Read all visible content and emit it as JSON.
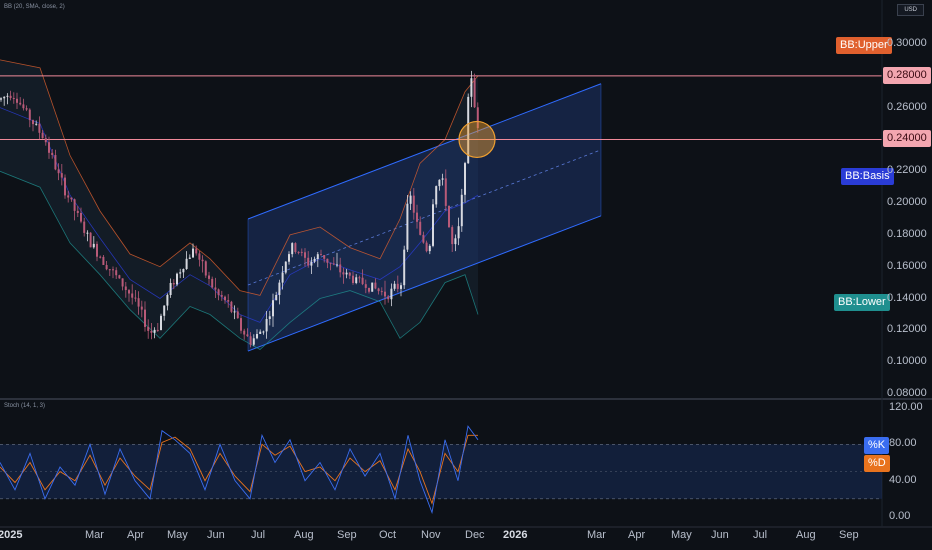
{
  "indicators": {
    "bb_legend": "BB (20, SMA, close, 2)",
    "stoch_legend": "Stoch (14, 1, 3)",
    "currency": "USD"
  },
  "labels": {
    "bb_upper": "BB:Upper",
    "bb_basis": "BB:Basis",
    "bb_lower": "BB:Lower",
    "level_high": "0.28000",
    "level_low": "0.24000",
    "pct_k": "%K",
    "pct_d": "%D"
  },
  "colors": {
    "background": "#0d1117",
    "candle_up": "#d7d9e0",
    "candle_down": "#b95a78",
    "bb_upper": "#e0602e",
    "bb_basis": "#2a3cd6",
    "bb_lower": "#1f8f8f",
    "level_line": "#f08a9a",
    "channel": "#2f6bff",
    "highlight_circle": "#f0a030",
    "stoch_k": "#3a6df0",
    "stoch_d": "#e8731e"
  },
  "chart_data": {
    "type": "line",
    "title": "",
    "main_y_ticks": [
      "0.30000",
      "0.28000",
      "0.26000",
      "0.24000",
      "0.22000",
      "0.20000",
      "0.18000",
      "0.16000",
      "0.14000",
      "0.12000",
      "0.10000",
      "0.08000"
    ],
    "main_ylim": [
      0.08,
      0.305
    ],
    "stoch_y_ticks": [
      "120.00",
      "80.00",
      "40.00",
      "0.00"
    ],
    "stoch_ylim": [
      0,
      120
    ],
    "x_ticks": [
      "2025",
      "Mar",
      "Apr",
      "May",
      "Jun",
      "Jul",
      "Aug",
      "Sep",
      "Oct",
      "Nov",
      "Dec",
      "2026",
      "Mar",
      "Apr",
      "May",
      "Jun",
      "Jul",
      "Aug",
      "Sep"
    ],
    "horizontal_levels": [
      0.28,
      0.24
    ],
    "stoch_band": [
      20,
      80
    ],
    "price_path": [
      [
        0,
        0.265
      ],
      [
        12,
        0.27
      ],
      [
        28,
        0.255
      ],
      [
        45,
        0.24
      ],
      [
        60,
        0.215
      ],
      [
        75,
        0.195
      ],
      [
        90,
        0.175
      ],
      [
        105,
        0.163
      ],
      [
        118,
        0.152
      ],
      [
        130,
        0.143
      ],
      [
        140,
        0.132
      ],
      [
        150,
        0.118
      ],
      [
        158,
        0.123
      ],
      [
        165,
        0.137
      ],
      [
        172,
        0.15
      ],
      [
        180,
        0.158
      ],
      [
        188,
        0.166
      ],
      [
        195,
        0.172
      ],
      [
        202,
        0.16
      ],
      [
        210,
        0.15
      ],
      [
        218,
        0.142
      ],
      [
        226,
        0.138
      ],
      [
        234,
        0.13
      ],
      [
        242,
        0.12
      ],
      [
        250,
        0.113
      ],
      [
        258,
        0.117
      ],
      [
        266,
        0.125
      ],
      [
        275,
        0.14
      ],
      [
        283,
        0.16
      ],
      [
        291,
        0.172
      ],
      [
        299,
        0.17
      ],
      [
        307,
        0.162
      ],
      [
        315,
        0.165
      ],
      [
        322,
        0.168
      ],
      [
        330,
        0.162
      ],
      [
        338,
        0.158
      ],
      [
        346,
        0.155
      ],
      [
        354,
        0.152
      ],
      [
        362,
        0.15
      ],
      [
        370,
        0.148
      ],
      [
        378,
        0.145
      ],
      [
        386,
        0.143
      ],
      [
        394,
        0.145
      ],
      [
        401,
        0.15
      ],
      [
        406,
        0.19
      ],
      [
        410,
        0.205
      ],
      [
        414,
        0.195
      ],
      [
        419,
        0.18
      ],
      [
        424,
        0.175
      ],
      [
        429,
        0.168
      ],
      [
        434,
        0.21
      ],
      [
        439,
        0.215
      ],
      [
        444,
        0.21
      ],
      [
        449,
        0.185
      ],
      [
        453,
        0.17
      ],
      [
        458,
        0.18
      ],
      [
        463,
        0.21
      ],
      [
        466,
        0.24
      ],
      [
        469,
        0.27
      ],
      [
        472,
        0.283
      ],
      [
        476,
        0.25
      ],
      [
        478,
        0.245
      ]
    ],
    "bb_upper_path": [
      [
        0,
        0.29
      ],
      [
        40,
        0.285
      ],
      [
        70,
        0.23
      ],
      [
        100,
        0.195
      ],
      [
        130,
        0.168
      ],
      [
        160,
        0.16
      ],
      [
        190,
        0.175
      ],
      [
        210,
        0.165
      ],
      [
        240,
        0.145
      ],
      [
        260,
        0.142
      ],
      [
        290,
        0.18
      ],
      [
        320,
        0.185
      ],
      [
        350,
        0.172
      ],
      [
        380,
        0.165
      ],
      [
        400,
        0.19
      ],
      [
        420,
        0.225
      ],
      [
        445,
        0.24
      ],
      [
        465,
        0.27
      ],
      [
        478,
        0.28
      ]
    ],
    "bb_basis_path": [
      [
        0,
        0.26
      ],
      [
        40,
        0.25
      ],
      [
        70,
        0.205
      ],
      [
        100,
        0.178
      ],
      [
        130,
        0.152
      ],
      [
        160,
        0.14
      ],
      [
        190,
        0.155
      ],
      [
        210,
        0.148
      ],
      [
        240,
        0.13
      ],
      [
        260,
        0.125
      ],
      [
        290,
        0.155
      ],
      [
        320,
        0.165
      ],
      [
        350,
        0.158
      ],
      [
        380,
        0.152
      ],
      [
        400,
        0.16
      ],
      [
        420,
        0.175
      ],
      [
        445,
        0.195
      ],
      [
        465,
        0.2
      ],
      [
        478,
        0.205
      ]
    ],
    "bb_lower_path": [
      [
        0,
        0.22
      ],
      [
        40,
        0.21
      ],
      [
        70,
        0.175
      ],
      [
        100,
        0.155
      ],
      [
        130,
        0.133
      ],
      [
        160,
        0.115
      ],
      [
        190,
        0.135
      ],
      [
        210,
        0.13
      ],
      [
        240,
        0.115
      ],
      [
        260,
        0.108
      ],
      [
        290,
        0.125
      ],
      [
        320,
        0.14
      ],
      [
        350,
        0.145
      ],
      [
        380,
        0.138
      ],
      [
        400,
        0.115
      ],
      [
        420,
        0.125
      ],
      [
        445,
        0.15
      ],
      [
        465,
        0.155
      ],
      [
        478,
        0.13
      ]
    ],
    "channel": {
      "upper_start": [
        248,
        0.19
      ],
      "upper_end": [
        601,
        0.275
      ],
      "lower_start": [
        248,
        0.107
      ],
      "lower_end": [
        601,
        0.192
      ]
    },
    "highlight": {
      "x": 477,
      "y": 0.24
    },
    "stoch_k_path": [
      [
        0,
        60
      ],
      [
        15,
        30
      ],
      [
        30,
        70
      ],
      [
        45,
        20
      ],
      [
        60,
        55
      ],
      [
        75,
        35
      ],
      [
        90,
        80
      ],
      [
        105,
        25
      ],
      [
        120,
        75
      ],
      [
        135,
        40
      ],
      [
        150,
        20
      ],
      [
        162,
        95
      ],
      [
        175,
        85
      ],
      [
        190,
        70
      ],
      [
        205,
        30
      ],
      [
        220,
        80
      ],
      [
        235,
        40
      ],
      [
        250,
        20
      ],
      [
        262,
        90
      ],
      [
        275,
        60
      ],
      [
        290,
        85
      ],
      [
        305,
        40
      ],
      [
        320,
        60
      ],
      [
        335,
        30
      ],
      [
        350,
        75
      ],
      [
        365,
        45
      ],
      [
        380,
        70
      ],
      [
        395,
        20
      ],
      [
        408,
        90
      ],
      [
        420,
        40
      ],
      [
        432,
        5
      ],
      [
        445,
        85
      ],
      [
        458,
        40
      ],
      [
        468,
        100
      ],
      [
        478,
        85
      ]
    ],
    "stoch_d_path": [
      [
        0,
        55
      ],
      [
        15,
        38
      ],
      [
        30,
        60
      ],
      [
        45,
        30
      ],
      [
        60,
        50
      ],
      [
        75,
        40
      ],
      [
        90,
        68
      ],
      [
        105,
        35
      ],
      [
        120,
        65
      ],
      [
        135,
        45
      ],
      [
        150,
        30
      ],
      [
        162,
        82
      ],
      [
        175,
        88
      ],
      [
        190,
        75
      ],
      [
        205,
        40
      ],
      [
        220,
        70
      ],
      [
        235,
        45
      ],
      [
        250,
        28
      ],
      [
        262,
        80
      ],
      [
        275,
        68
      ],
      [
        290,
        78
      ],
      [
        305,
        50
      ],
      [
        320,
        55
      ],
      [
        335,
        40
      ],
      [
        350,
        65
      ],
      [
        365,
        50
      ],
      [
        380,
        62
      ],
      [
        395,
        30
      ],
      [
        408,
        75
      ],
      [
        420,
        50
      ],
      [
        432,
        15
      ],
      [
        445,
        70
      ],
      [
        458,
        50
      ],
      [
        468,
        90
      ],
      [
        478,
        90
      ]
    ]
  }
}
